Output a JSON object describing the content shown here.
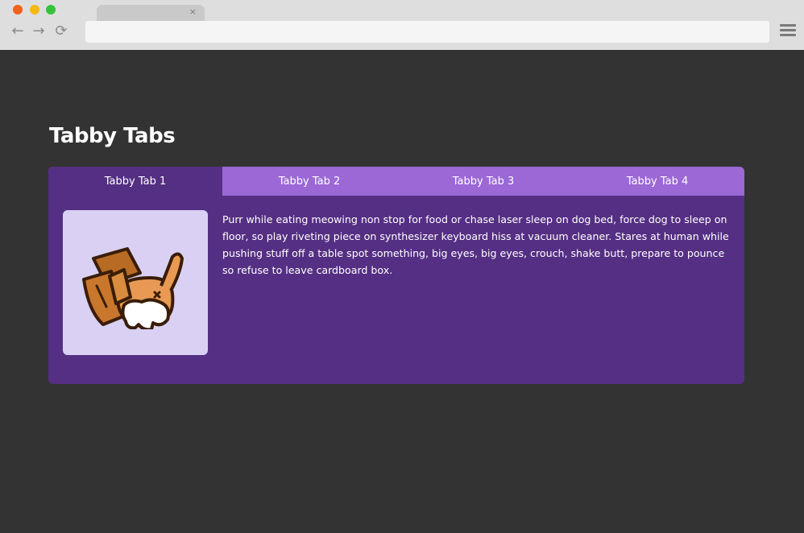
{
  "browser": {
    "tab_close": "×",
    "nav": {
      "back": "←",
      "forward": "→",
      "reload": "⟳"
    }
  },
  "page": {
    "title": "Tabby Tabs",
    "tabs": [
      {
        "label": "Tabby Tab 1",
        "active": true
      },
      {
        "label": "Tabby Tab 2",
        "active": false
      },
      {
        "label": "Tabby Tab 3",
        "active": false
      },
      {
        "label": "Tabby Tab 4",
        "active": false
      }
    ],
    "panel": {
      "image_icon": "cat-in-box-icon",
      "text": "Purr while eating meowing non stop for food or chase laser sleep on dog bed, force dog to sleep on floor, so play riveting piece on synthesizer keyboard hiss at vacuum cleaner. Stares at human while pushing stuff off a table spot something, big eyes, big eyes, crouch, shake butt, prepare to pounce so refuse to leave cardboard box."
    }
  },
  "colors": {
    "background": "#333333",
    "card": "#552f83",
    "tab_inactive": "#9b68d6",
    "thumb_bg": "#d9d0f4"
  }
}
